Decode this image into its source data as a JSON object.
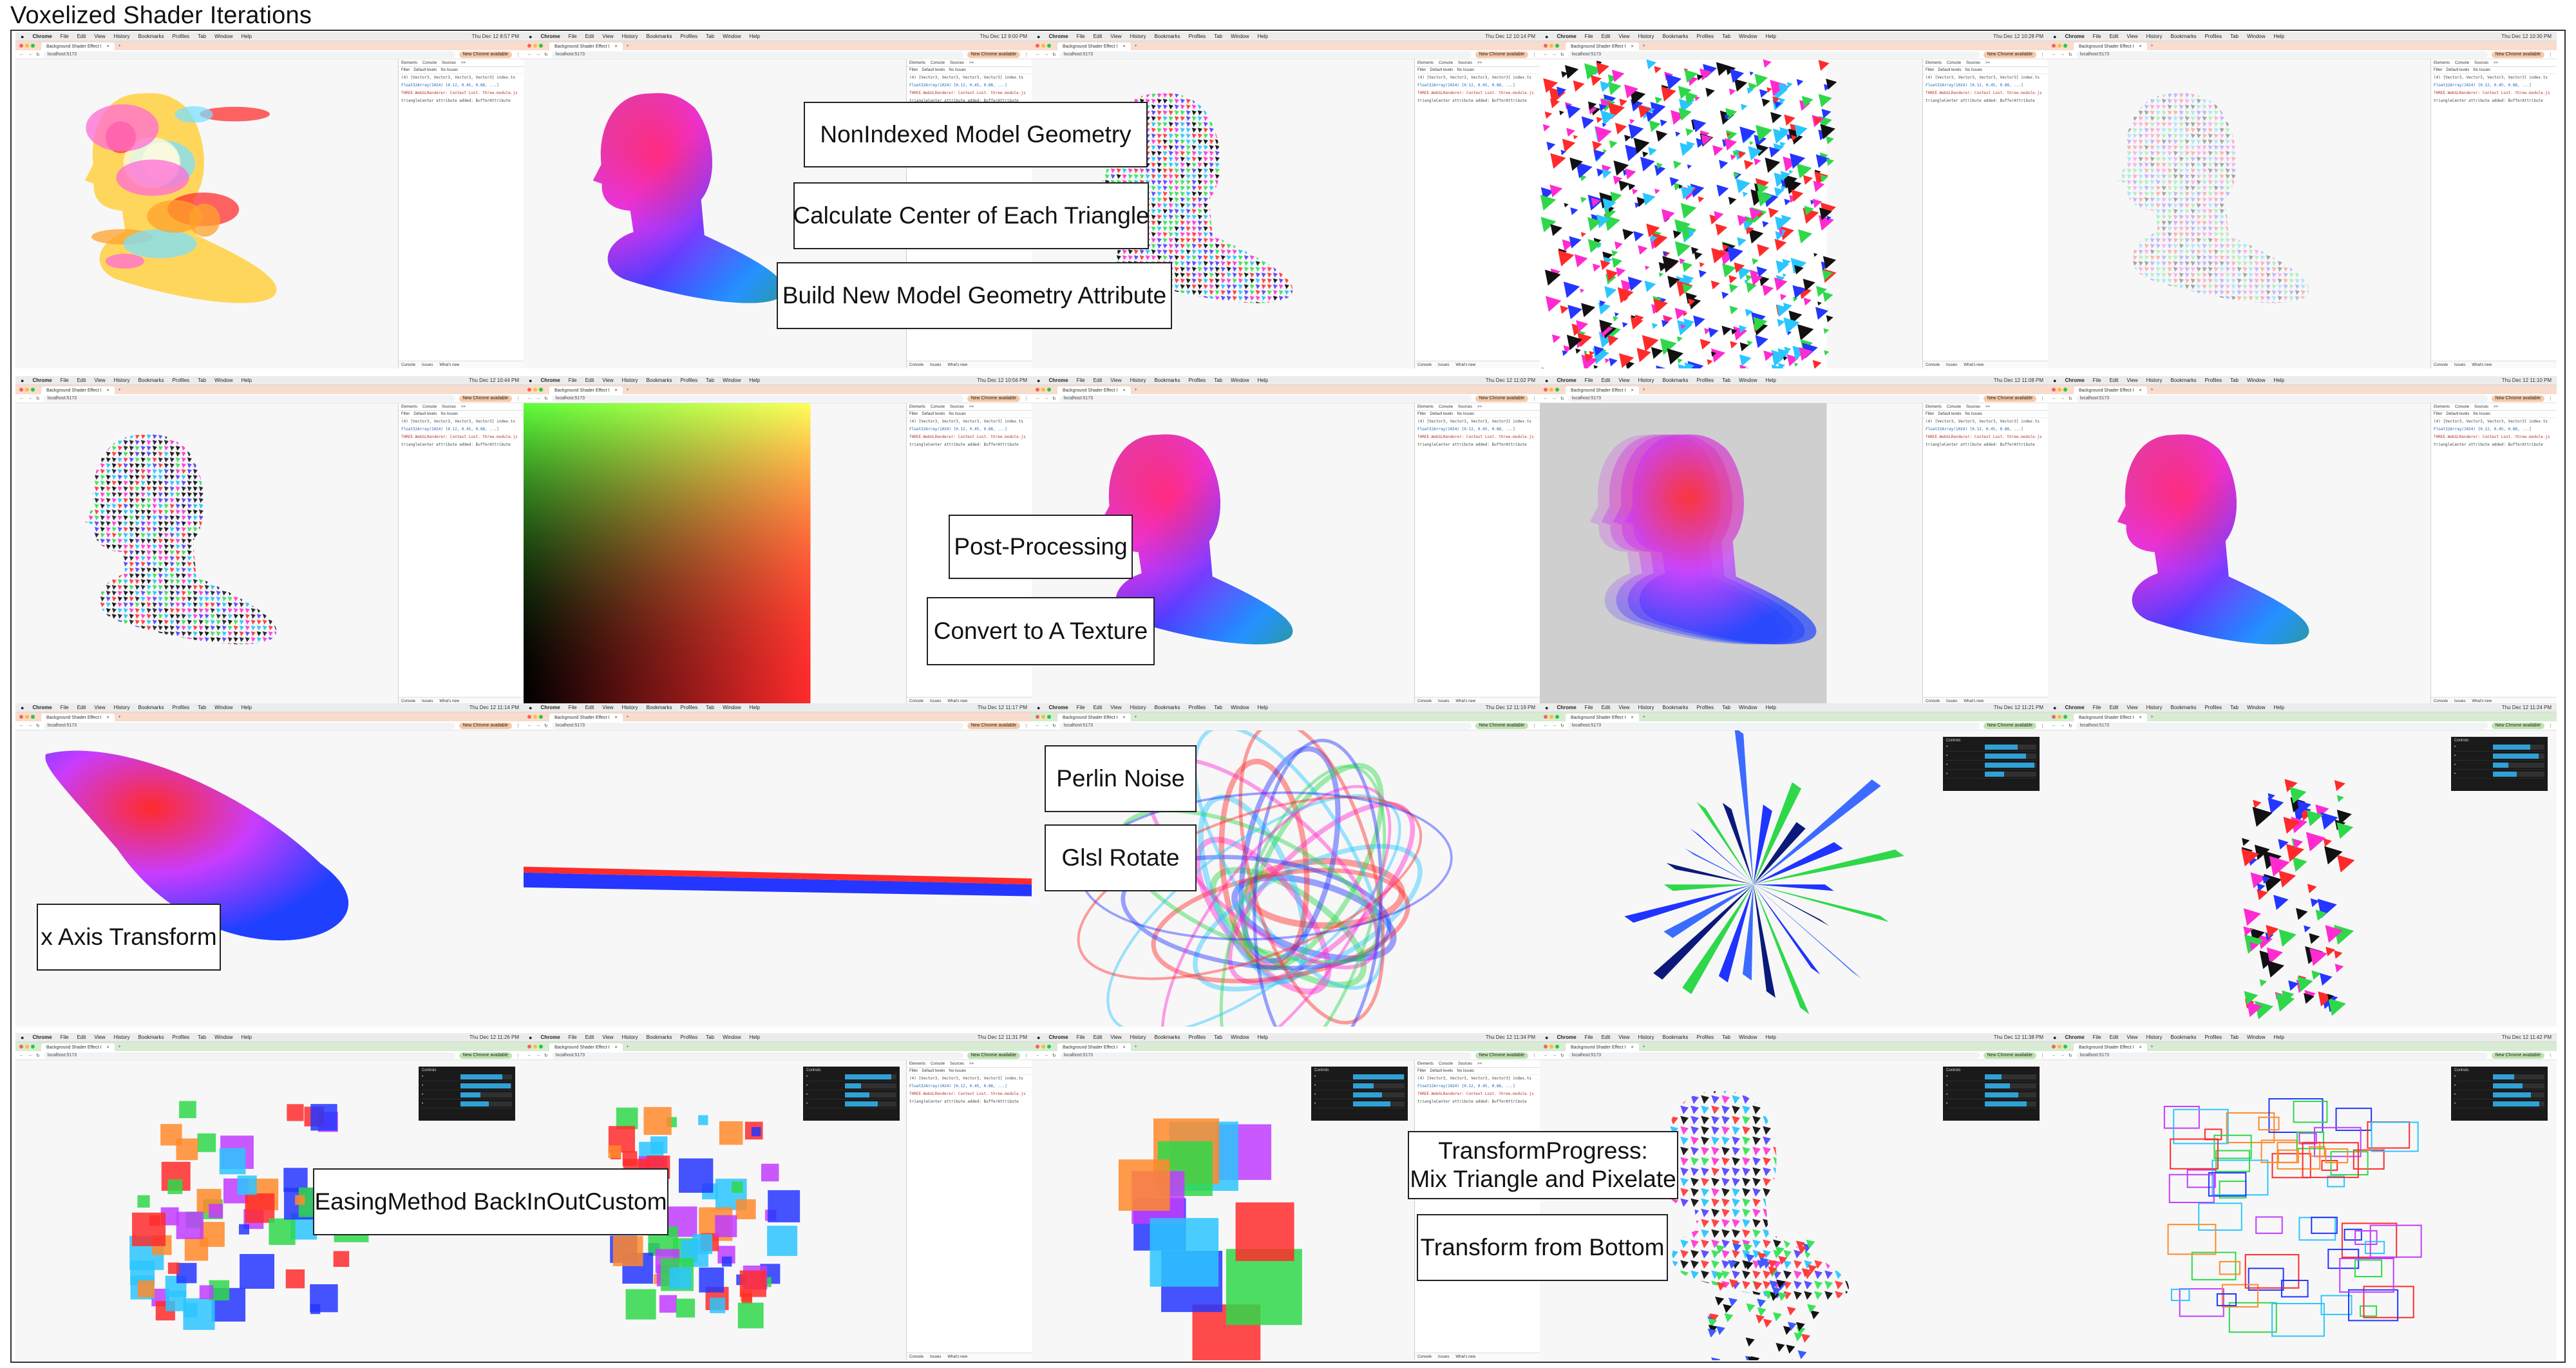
{
  "board": {
    "title": "Voxelized Shader Iterations"
  },
  "browser": {
    "menu_items": [
      "Chrome",
      "File",
      "Edit",
      "View",
      "History",
      "Bookmarks",
      "Profiles",
      "Tab",
      "Window",
      "Help"
    ],
    "tab_title": "Background Shader Effect I",
    "url": "localhost:5173",
    "update_badge": "New Chrome available",
    "devtools_tabs": [
      "Elements",
      "Console",
      "Sources",
      ">>"
    ],
    "devtools_filter": "Filter",
    "default_levels": "Default levels",
    "no_issues": "No Issues",
    "drawer_tabs": [
      "Console",
      "Issues",
      "What's new"
    ],
    "gui_title": "Controls",
    "clocks": [
      "Thu Dec 12 8:57 PM",
      "Thu Dec 12 9:00 PM",
      "Thu Dec 12 10:14 PM",
      "Thu Dec 12 10:28 PM",
      "Thu Dec 12 10:30 PM",
      "Thu Dec 12 10:44 PM",
      "Thu Dec 12 10:56 PM",
      "Thu Dec 12 11:02 PM",
      "Thu Dec 12 11:08 PM",
      "Thu Dec 12 11:10 PM",
      "Thu Dec 12 11:14 PM",
      "Thu Dec 12 11:17 PM",
      "Thu Dec 12 11:19 PM",
      "Thu Dec 12 11:21 PM",
      "Thu Dec 12 11:24 PM",
      "Thu Dec 12 11:26 PM",
      "Thu Dec 12 11:31 PM",
      "Thu Dec 12 11:34 PM",
      "Thu Dec 12 11:38 PM",
      "Thu Dec 12 11:42 PM"
    ],
    "log_lines": [
      "(4) [Vector3, Vector3, Vector3, Vector3] index.ts",
      "Float32Array(1024) [0.12, 0.45, 0.88, ...]",
      "THREE.WebGLRenderer: Context Lost. three.module.js",
      "triangleCenter attribute added: BufferAttribute"
    ]
  },
  "annotations": {
    "nonindexed": "NonIndexed Model Geometry",
    "center": "Calculate Center of Each Triangle",
    "build_attr": "Build New Model Geometry Attribute",
    "post_processing": "Post-Processing",
    "texture": "Convert to A Texture",
    "x_axis": "x Axis Transform",
    "perlin": "Perlin Noise",
    "glsl_rotate": "Glsl Rotate",
    "easing": "EasingMethod BackInOutCustom",
    "transform_progress_1": "TransformProgress:",
    "transform_progress_2": "Mix Triangle and Pixelate",
    "transform_bottom": "Transform from Bottom"
  },
  "colors": {
    "red": "#ff2b2b",
    "green": "#2fd84a",
    "blue": "#2436ff",
    "accent_orange": "#f8dccd",
    "accent_green": "#d7ecd2"
  }
}
